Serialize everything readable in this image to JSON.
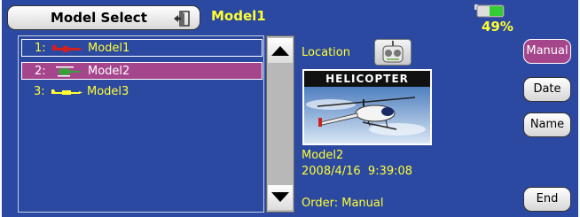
{
  "header": {
    "title": "Model Select",
    "current_model": "Model1",
    "battery_percent": "49%",
    "battery_level": 0.49
  },
  "models": [
    {
      "num": "1:",
      "name": "Model1",
      "icon": "airplane-icon",
      "color": "#d22020"
    },
    {
      "num": "2:",
      "name": "Model2",
      "icon": "helicopter-icon",
      "color": "#3aa03a"
    },
    {
      "num": "3:",
      "name": "Model3",
      "icon": "glider-icon",
      "color": "#ffff33"
    }
  ],
  "info": {
    "location_label": "Location",
    "preview_title": "HELICOPTER",
    "model_name": "Model2",
    "date": "2008/4/16  9:39:08",
    "order": "Order: Manual"
  },
  "buttons": {
    "manual": "Manual",
    "date": "Date",
    "name": "Name",
    "end": "End"
  },
  "colors": {
    "background": "#2b49a0",
    "text": "#ffff33",
    "selected": "#a5468c"
  }
}
